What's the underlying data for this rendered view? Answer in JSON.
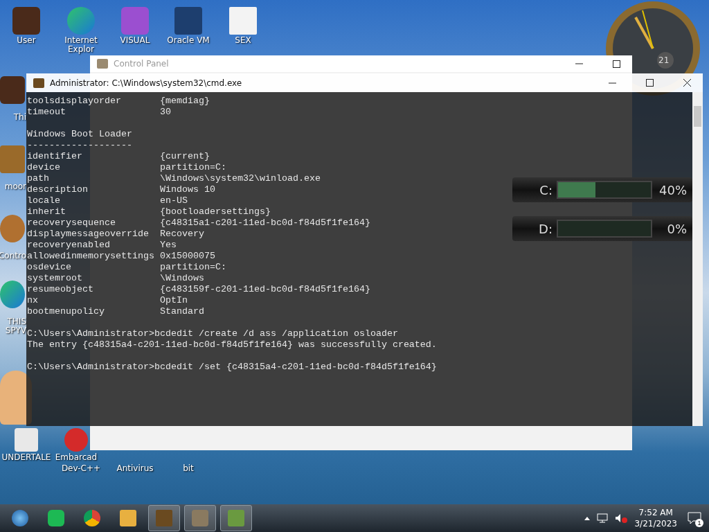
{
  "desktop_icons": [
    {
      "label": "User",
      "kind": "folder"
    },
    {
      "label": "Internet Explor",
      "kind": "browser"
    },
    {
      "label": "VISUAL",
      "kind": "studio"
    },
    {
      "label": "Oracle VM",
      "kind": "cube"
    },
    {
      "label": "SEX",
      "kind": "hxd"
    },
    {
      "label": "Thi",
      "kind": "folder"
    },
    {
      "label": "moor",
      "kind": "box"
    },
    {
      "label": "Contro",
      "kind": "globe"
    },
    {
      "label": "THIS",
      "kind": "browser"
    },
    {
      "label": "SPYV",
      "kind": "blank"
    },
    {
      "label": "UNDERTALE",
      "kind": "unity"
    },
    {
      "label": "Embarcad",
      "kind": "dev"
    },
    {
      "label": "Dev-C++",
      "kind": "blank"
    },
    {
      "label": "Antivirus",
      "kind": "blank"
    },
    {
      "label": "bit",
      "kind": "blank"
    }
  ],
  "clock": {
    "date": "21"
  },
  "drives": [
    {
      "letter": "C:",
      "reading": "40%",
      "level": 0.4
    },
    {
      "letter": "D:",
      "reading": "0%"
    }
  ],
  "control_panel": {
    "title": "Control Panel"
  },
  "cmd": {
    "title": "Administrator: C:\\Windows\\system32\\cmd.exe",
    "lines": [
      {
        "kind": "pair",
        "key": "toolsdisplayorder",
        "value": "{memdiag}"
      },
      {
        "kind": "pair",
        "key": "timeout",
        "value": "30"
      },
      {
        "kind": "blank"
      },
      {
        "kind": "text",
        "text": "Windows Boot Loader"
      },
      {
        "kind": "text",
        "text": "-------------------"
      },
      {
        "kind": "pair",
        "key": "identifier",
        "value": "{current}"
      },
      {
        "kind": "pair",
        "key": "device",
        "value": "partition=C:"
      },
      {
        "kind": "pair",
        "key": "path",
        "value": "\\Windows\\system32\\winload.exe"
      },
      {
        "kind": "pair",
        "key": "description",
        "value": "Windows 10"
      },
      {
        "kind": "pair",
        "key": "locale",
        "value": "en-US"
      },
      {
        "kind": "pair",
        "key": "inherit",
        "value": "{bootloadersettings}"
      },
      {
        "kind": "pair",
        "key": "recoverysequence",
        "value": "{c48315a1-c201-11ed-bc0d-f84d5f1fe164}"
      },
      {
        "kind": "pair",
        "key": "displaymessageoverride",
        "value": "Recovery"
      },
      {
        "kind": "pair",
        "key": "recoveryenabled",
        "value": "Yes"
      },
      {
        "kind": "pair",
        "key": "allowedinmemorysettings",
        "value": "0x15000075"
      },
      {
        "kind": "pair",
        "key": "osdevice",
        "value": "partition=C:"
      },
      {
        "kind": "pair",
        "key": "systemroot",
        "value": "\\Windows"
      },
      {
        "kind": "pair",
        "key": "resumeobject",
        "value": "{c483159f-c201-11ed-bc0d-f84d5f1fe164}"
      },
      {
        "kind": "pair",
        "key": "nx",
        "value": "OptIn"
      },
      {
        "kind": "pair",
        "key": "bootmenupolicy",
        "value": "Standard"
      },
      {
        "kind": "blank"
      },
      {
        "kind": "text",
        "text": "C:\\Users\\Administrator>bcdedit /create /d ass /application osloader"
      },
      {
        "kind": "text",
        "text": "The entry {c48315a4-c201-11ed-bc0d-f84d5f1fe164} was successfully created."
      },
      {
        "kind": "blank"
      },
      {
        "kind": "text",
        "text": "C:\\Users\\Administrator>bcdedit /set {c48315a4-c201-11ed-bc0d-f84d5f1fe164}"
      }
    ]
  },
  "taskbar": {
    "apps": [
      {
        "kind": "chat",
        "active": false
      },
      {
        "kind": "chrome",
        "active": false
      },
      {
        "kind": "folder",
        "active": false
      },
      {
        "kind": "cmd",
        "active": true
      },
      {
        "kind": "panel",
        "active": true
      },
      {
        "kind": "game",
        "active": true
      }
    ],
    "time": "7:52 AM",
    "date": "3/21/2023",
    "notifications": "1"
  }
}
